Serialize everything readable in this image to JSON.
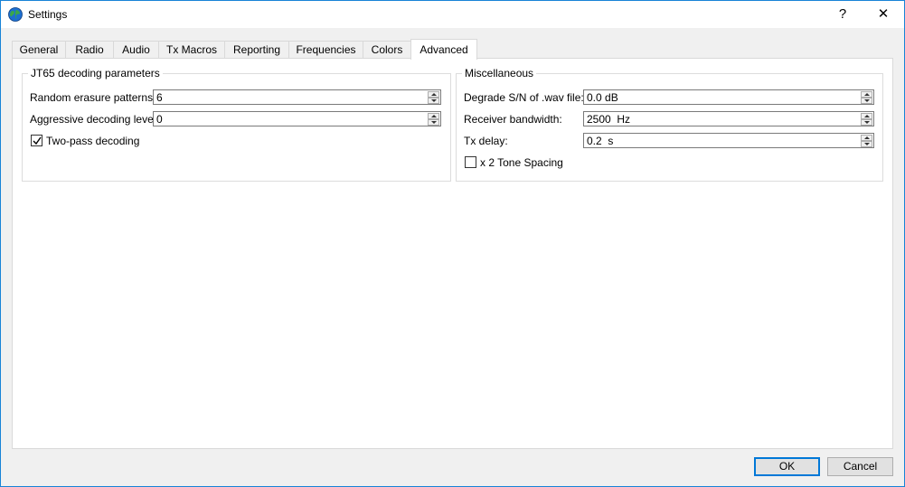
{
  "window": {
    "title": "Settings",
    "help_label": "?",
    "close_label": "✕"
  },
  "tabs": [
    {
      "label": "General"
    },
    {
      "label": "Radio"
    },
    {
      "label": "Audio"
    },
    {
      "label": "Tx Macros"
    },
    {
      "label": "Reporting"
    },
    {
      "label": "Frequencies"
    },
    {
      "label": "Colors"
    },
    {
      "label": "Advanced",
      "active": true
    }
  ],
  "jt65": {
    "title": "JT65 decoding parameters",
    "random_erasure_label": "Random erasure patterns:",
    "random_erasure_value": "6",
    "aggressive_label": "Aggressive decoding level:",
    "aggressive_value": "0",
    "two_pass_label": "Two-pass decoding",
    "two_pass_checked": true
  },
  "misc": {
    "title": "Miscellaneous",
    "degrade_label": "Degrade S/N of .wav file:",
    "degrade_value": "0.0 dB",
    "bandwidth_label": "Receiver bandwidth:",
    "bandwidth_value": "2500  Hz",
    "tx_delay_label": "Tx delay:",
    "tx_delay_value": "0.2  s",
    "tone_spacing_label": "x 2 Tone Spacing",
    "tone_spacing_checked": false
  },
  "buttons": {
    "ok": "OK",
    "cancel": "Cancel"
  },
  "colors": {
    "accent": "#0078d7",
    "window_border": "#1883d7"
  },
  "icons": {
    "app": "globe-icon"
  }
}
